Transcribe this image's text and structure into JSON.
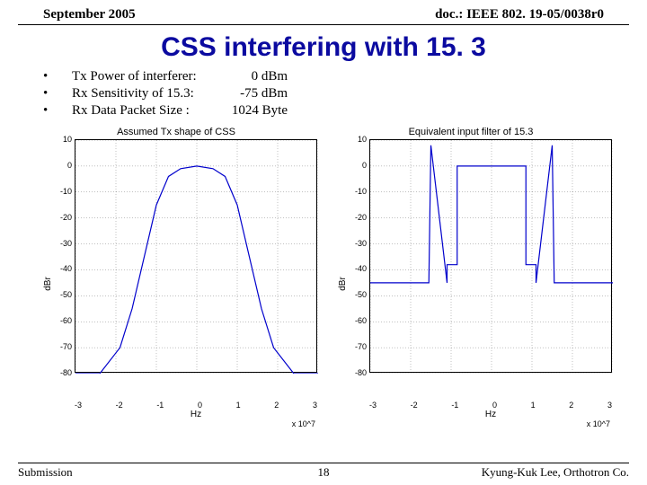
{
  "header": {
    "left": "September 2005",
    "right": "doc.: IEEE 802. 19-05/0038r0"
  },
  "title": "CSS interfering with 15. 3",
  "bullets": [
    {
      "label": "Tx Power of interferer:",
      "value": "0 dBm"
    },
    {
      "label": "Rx Sensitivity of 15.3:",
      "value": "-75 dBm"
    },
    {
      "label": "Rx Data Packet Size :",
      "value": "1024 Byte"
    }
  ],
  "footer": {
    "left": "Submission",
    "center": "18",
    "right": "Kyung-Kuk Lee, Orthotron Co."
  },
  "chart_data": [
    {
      "type": "line",
      "title": "Assumed Tx shape of CSS",
      "xlabel": "Hz",
      "ylabel": "dBr",
      "xmult": "x 10^7",
      "xlim": [
        -3,
        3
      ],
      "ylim": [
        -80,
        10
      ],
      "xticks": [
        -3,
        -2,
        -1,
        0,
        1,
        2,
        3
      ],
      "yticks": [
        10,
        0,
        -10,
        -20,
        -30,
        -40,
        -50,
        -60,
        -70,
        -80
      ],
      "x": [
        -3.0,
        -2.4,
        -1.9,
        -1.6,
        -1.3,
        -1.0,
        -0.7,
        -0.4,
        0.0,
        0.4,
        0.7,
        1.0,
        1.3,
        1.6,
        1.9,
        2.4,
        3.0
      ],
      "y": [
        -80,
        -80,
        -70,
        -55,
        -35,
        -15,
        -4,
        -1,
        0,
        -1,
        -4,
        -15,
        -35,
        -55,
        -70,
        -80,
        -80
      ]
    },
    {
      "type": "line",
      "title": "Equivalent input filter of 15.3",
      "xlabel": "Hz",
      "ylabel": "dBr",
      "xmult": "x 10^7",
      "xlim": [
        -3,
        3
      ],
      "ylim": [
        -80,
        10
      ],
      "xticks": [
        -3,
        -2,
        -1,
        0,
        1,
        2,
        3
      ],
      "yticks": [
        10,
        0,
        -10,
        -20,
        -30,
        -40,
        -50,
        -60,
        -70,
        -80
      ],
      "x": [
        -3.0,
        -1.55,
        -1.5,
        -1.1,
        -1.1,
        -0.85,
        -0.85,
        0.85,
        0.85,
        1.1,
        1.1,
        1.5,
        1.55,
        3.0
      ],
      "y": [
        -45,
        -45,
        8,
        -45,
        -38,
        -38,
        0,
        0,
        -38,
        -38,
        -45,
        8,
        -45,
        -45
      ]
    }
  ]
}
